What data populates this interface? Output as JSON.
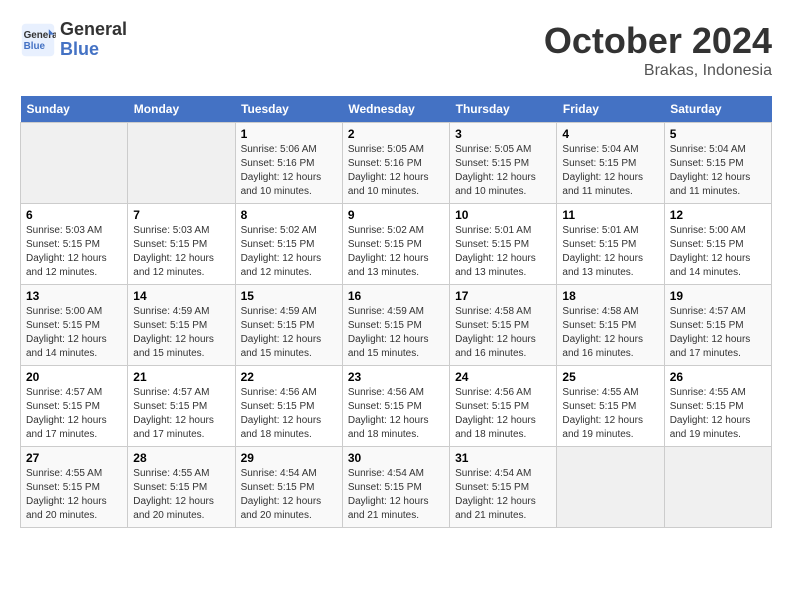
{
  "header": {
    "logo_line1": "General",
    "logo_line2": "Blue",
    "month": "October 2024",
    "location": "Brakas, Indonesia"
  },
  "weekdays": [
    "Sunday",
    "Monday",
    "Tuesday",
    "Wednesday",
    "Thursday",
    "Friday",
    "Saturday"
  ],
  "weeks": [
    [
      {
        "day": "",
        "info": ""
      },
      {
        "day": "",
        "info": ""
      },
      {
        "day": "1",
        "info": "Sunrise: 5:06 AM\nSunset: 5:16 PM\nDaylight: 12 hours\nand 10 minutes."
      },
      {
        "day": "2",
        "info": "Sunrise: 5:05 AM\nSunset: 5:16 PM\nDaylight: 12 hours\nand 10 minutes."
      },
      {
        "day": "3",
        "info": "Sunrise: 5:05 AM\nSunset: 5:15 PM\nDaylight: 12 hours\nand 10 minutes."
      },
      {
        "day": "4",
        "info": "Sunrise: 5:04 AM\nSunset: 5:15 PM\nDaylight: 12 hours\nand 11 minutes."
      },
      {
        "day": "5",
        "info": "Sunrise: 5:04 AM\nSunset: 5:15 PM\nDaylight: 12 hours\nand 11 minutes."
      }
    ],
    [
      {
        "day": "6",
        "info": "Sunrise: 5:03 AM\nSunset: 5:15 PM\nDaylight: 12 hours\nand 12 minutes."
      },
      {
        "day": "7",
        "info": "Sunrise: 5:03 AM\nSunset: 5:15 PM\nDaylight: 12 hours\nand 12 minutes."
      },
      {
        "day": "8",
        "info": "Sunrise: 5:02 AM\nSunset: 5:15 PM\nDaylight: 12 hours\nand 12 minutes."
      },
      {
        "day": "9",
        "info": "Sunrise: 5:02 AM\nSunset: 5:15 PM\nDaylight: 12 hours\nand 13 minutes."
      },
      {
        "day": "10",
        "info": "Sunrise: 5:01 AM\nSunset: 5:15 PM\nDaylight: 12 hours\nand 13 minutes."
      },
      {
        "day": "11",
        "info": "Sunrise: 5:01 AM\nSunset: 5:15 PM\nDaylight: 12 hours\nand 13 minutes."
      },
      {
        "day": "12",
        "info": "Sunrise: 5:00 AM\nSunset: 5:15 PM\nDaylight: 12 hours\nand 14 minutes."
      }
    ],
    [
      {
        "day": "13",
        "info": "Sunrise: 5:00 AM\nSunset: 5:15 PM\nDaylight: 12 hours\nand 14 minutes."
      },
      {
        "day": "14",
        "info": "Sunrise: 4:59 AM\nSunset: 5:15 PM\nDaylight: 12 hours\nand 15 minutes."
      },
      {
        "day": "15",
        "info": "Sunrise: 4:59 AM\nSunset: 5:15 PM\nDaylight: 12 hours\nand 15 minutes."
      },
      {
        "day": "16",
        "info": "Sunrise: 4:59 AM\nSunset: 5:15 PM\nDaylight: 12 hours\nand 15 minutes."
      },
      {
        "day": "17",
        "info": "Sunrise: 4:58 AM\nSunset: 5:15 PM\nDaylight: 12 hours\nand 16 minutes."
      },
      {
        "day": "18",
        "info": "Sunrise: 4:58 AM\nSunset: 5:15 PM\nDaylight: 12 hours\nand 16 minutes."
      },
      {
        "day": "19",
        "info": "Sunrise: 4:57 AM\nSunset: 5:15 PM\nDaylight: 12 hours\nand 17 minutes."
      }
    ],
    [
      {
        "day": "20",
        "info": "Sunrise: 4:57 AM\nSunset: 5:15 PM\nDaylight: 12 hours\nand 17 minutes."
      },
      {
        "day": "21",
        "info": "Sunrise: 4:57 AM\nSunset: 5:15 PM\nDaylight: 12 hours\nand 17 minutes."
      },
      {
        "day": "22",
        "info": "Sunrise: 4:56 AM\nSunset: 5:15 PM\nDaylight: 12 hours\nand 18 minutes."
      },
      {
        "day": "23",
        "info": "Sunrise: 4:56 AM\nSunset: 5:15 PM\nDaylight: 12 hours\nand 18 minutes."
      },
      {
        "day": "24",
        "info": "Sunrise: 4:56 AM\nSunset: 5:15 PM\nDaylight: 12 hours\nand 18 minutes."
      },
      {
        "day": "25",
        "info": "Sunrise: 4:55 AM\nSunset: 5:15 PM\nDaylight: 12 hours\nand 19 minutes."
      },
      {
        "day": "26",
        "info": "Sunrise: 4:55 AM\nSunset: 5:15 PM\nDaylight: 12 hours\nand 19 minutes."
      }
    ],
    [
      {
        "day": "27",
        "info": "Sunrise: 4:55 AM\nSunset: 5:15 PM\nDaylight: 12 hours\nand 20 minutes."
      },
      {
        "day": "28",
        "info": "Sunrise: 4:55 AM\nSunset: 5:15 PM\nDaylight: 12 hours\nand 20 minutes."
      },
      {
        "day": "29",
        "info": "Sunrise: 4:54 AM\nSunset: 5:15 PM\nDaylight: 12 hours\nand 20 minutes."
      },
      {
        "day": "30",
        "info": "Sunrise: 4:54 AM\nSunset: 5:15 PM\nDaylight: 12 hours\nand 21 minutes."
      },
      {
        "day": "31",
        "info": "Sunrise: 4:54 AM\nSunset: 5:15 PM\nDaylight: 12 hours\nand 21 minutes."
      },
      {
        "day": "",
        "info": ""
      },
      {
        "day": "",
        "info": ""
      }
    ]
  ]
}
